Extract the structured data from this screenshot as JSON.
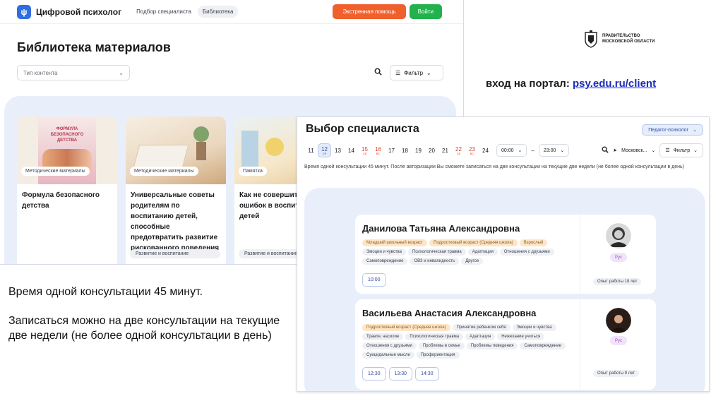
{
  "library": {
    "logo_text": "Цифровой психолог",
    "nav": [
      "Подбор специалиста",
      "Библиотека"
    ],
    "emergency_label": "Экстренная помощь",
    "login_label": "Войти",
    "title": "Библиотека материалов",
    "content_type_placeholder": "Тип контента",
    "filter_label": "Фильтр",
    "cards": [
      {
        "tag": "Методические материалы",
        "title": "Формула безопасного детства",
        "chip": "",
        "cover_line1": "ФОРМУЛА",
        "cover_line2": "БЕЗОПАСНОГО",
        "cover_line3": "ДЕТСТВА"
      },
      {
        "tag": "Методические материалы",
        "title": "Универсальные советы родителям по воспитанию детей, способные предотвратить развитие рискованного поведения",
        "chip": "Развитие и воспитание"
      },
      {
        "tag": "Памятка",
        "title": "Как не совершить ошибок в воспитании детей",
        "chip": "Развитие и воспитание"
      }
    ]
  },
  "branding": {
    "gov_line1": "ПРАВИТЕЛЬСТВО",
    "gov_line2": "МОСКОВСКОЙ ОБЛАСТИ",
    "portal_prefix": "вход на портал:",
    "portal_link": "psy.edu.ru/client"
  },
  "note": {
    "p1": "Время одной консультации 45 минут.",
    "p2": "Записаться можно на две консультации на текущие две недели (не более одной консультации в день)"
  },
  "specialists": {
    "title": "Выбор специалиста",
    "role_select": "Педагог-психолог",
    "days": [
      {
        "num": "11",
        "red": false,
        "sel": false,
        "sub": ""
      },
      {
        "num": "12",
        "red": false,
        "sel": true,
        "sub": "СР"
      },
      {
        "num": "13",
        "red": false,
        "sel": false,
        "sub": ""
      },
      {
        "num": "14",
        "red": false,
        "sel": false,
        "sub": ""
      },
      {
        "num": "15",
        "red": true,
        "sel": false,
        "sub": "СБ"
      },
      {
        "num": "16",
        "red": true,
        "sel": false,
        "sub": "ВС"
      },
      {
        "num": "17",
        "red": false,
        "sel": false,
        "sub": ""
      },
      {
        "num": "18",
        "red": false,
        "sel": false,
        "sub": ""
      },
      {
        "num": "19",
        "red": false,
        "sel": false,
        "sub": ""
      },
      {
        "num": "20",
        "red": false,
        "sel": false,
        "sub": ""
      },
      {
        "num": "21",
        "red": false,
        "sel": false,
        "sub": ""
      },
      {
        "num": "22",
        "red": true,
        "sel": false,
        "sub": "СБ"
      },
      {
        "num": "23",
        "red": true,
        "sel": false,
        "sub": "ВС"
      },
      {
        "num": "24",
        "red": false,
        "sel": false,
        "sub": ""
      }
    ],
    "time_from": "00:00",
    "time_to": "23:00",
    "time_dash": "–",
    "location": "Московск...",
    "filter_label": "Фильтр",
    "info": "Время одной консультации 45 минут. После авторизации Вы сможете записаться на две консультации на текущие две недели (не более одной консультации в день)",
    "cards": [
      {
        "name": "Данилова Татьяна Александровна",
        "age_chips": [
          "Младший школьный возраст",
          "Подростковый возраст (Средняя школа)",
          "Взрослый"
        ],
        "chips": [
          "Эмоции и чувства",
          "Психологическая травма",
          "Адаптация",
          "Отношения с друзьями",
          "Самоповреждение",
          "ОВЗ и инвалидность",
          "Другое"
        ],
        "slots": [
          "10:00"
        ],
        "lang": "Рус",
        "experience": "Опыт работы 18 лет"
      },
      {
        "name": "Васильева Анастасия Александровна",
        "age_chips": [
          "Подростковый возраст (Средняя школа)"
        ],
        "chips": [
          "Принятие ребенком себя",
          "Эмоции и чувства",
          "Травля, насилие",
          "Психологическая травма",
          "Адаптация",
          "Нежелание учиться",
          "Отношения с друзьями",
          "Проблемы в семье",
          "Проблемы поведения",
          "Самоповреждение",
          "Суицидальные мысли",
          "Профориентация"
        ],
        "slots": [
          "12:30",
          "13:30",
          "14:30"
        ],
        "lang": "Рус",
        "experience": "Опыт работы 9 лет"
      }
    ]
  }
}
